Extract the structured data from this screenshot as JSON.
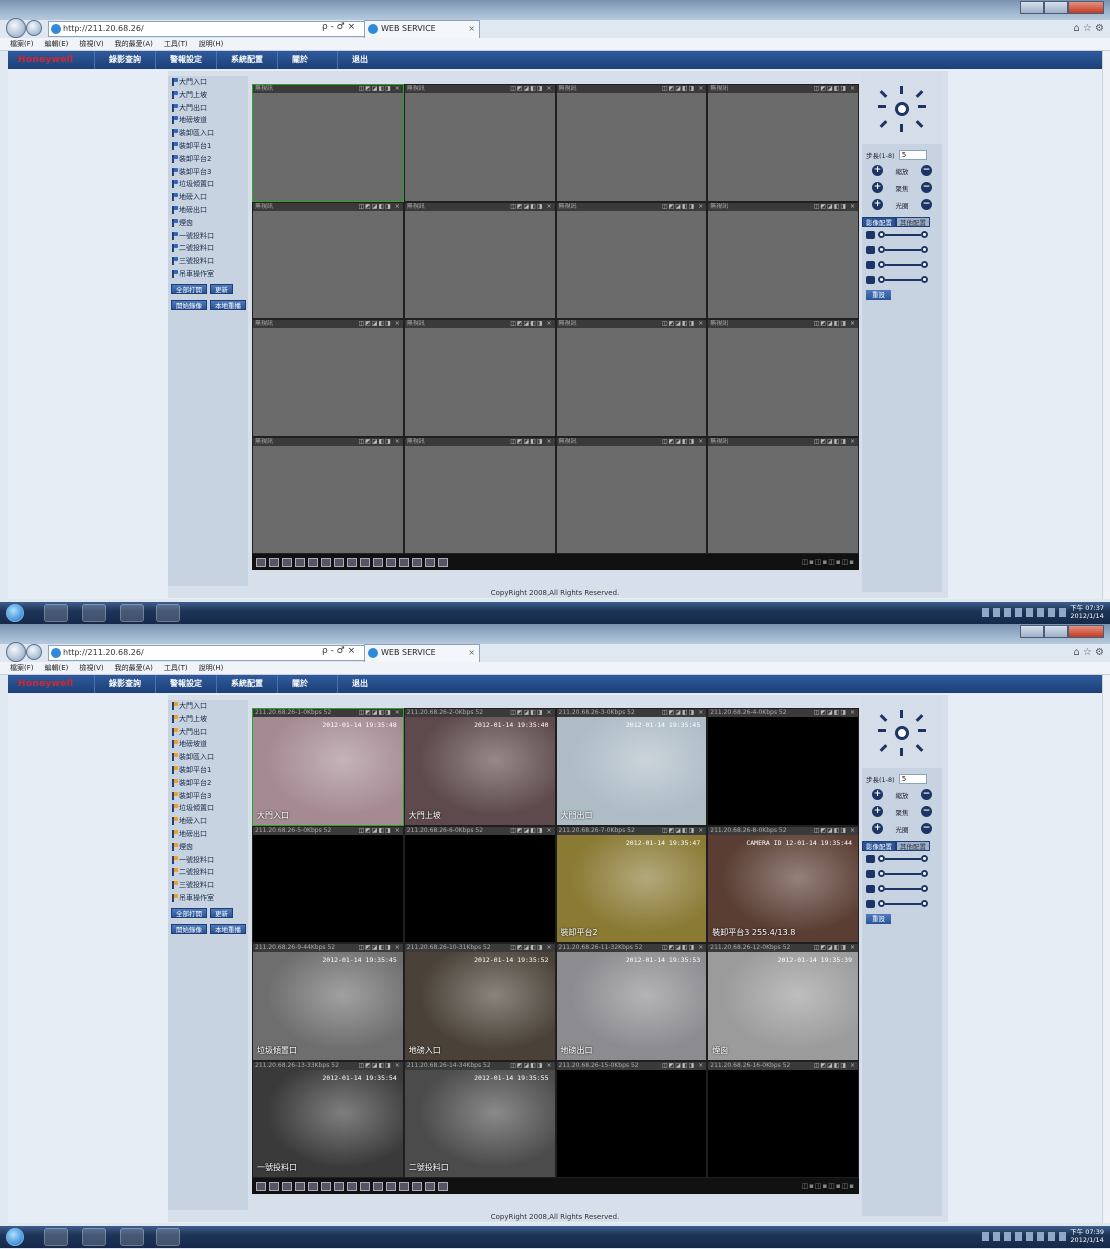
{
  "browser": {
    "url_1": "http://211.20.68.26/",
    "url_2": "http://211.20.68.26/",
    "addr_controls": "ρ - ♂ ×",
    "tab_label": "WEB SERVICE",
    "tab_close": "×"
  },
  "menu": [
    "檔案(F)",
    "編輯(E)",
    "檢視(V)",
    "我的最愛(A)",
    "工具(T)",
    "說明(H)"
  ],
  "nav": {
    "logo": "Honeywell",
    "items": [
      "錄影查詢",
      "警報設定",
      "系統配置",
      "關於",
      "退出"
    ]
  },
  "tree": {
    "items": [
      "大門入口",
      "大門上坡",
      "大門出口",
      "地磅坡道",
      "裝卸區入口",
      "裝卸平台1",
      "裝卸平台2",
      "裝卸平台3",
      "垃圾傾置口",
      "地磅入口",
      "地磅出口",
      "煙囪",
      "一號投料口",
      "二號投料口",
      "三號投料口",
      "吊車操作室"
    ],
    "btn_open_all": "全部打開",
    "btn_refresh": "更新",
    "btn_start_record": "開始錄像",
    "btn_local_playback": "本地重播"
  },
  "screen1": {
    "cells": [
      {
        "hdr": "無視訊"
      },
      {
        "hdr": "無視訊"
      },
      {
        "hdr": "無視訊"
      },
      {
        "hdr": "無視訊"
      },
      {
        "hdr": "無視訊"
      },
      {
        "hdr": "無視訊"
      },
      {
        "hdr": "無視訊"
      },
      {
        "hdr": "無視訊"
      },
      {
        "hdr": "無視訊"
      },
      {
        "hdr": "無視訊"
      },
      {
        "hdr": "無視訊"
      },
      {
        "hdr": "無視訊"
      },
      {
        "hdr": "無視訊"
      },
      {
        "hdr": "無視訊"
      },
      {
        "hdr": "無視訊"
      },
      {
        "hdr": "無視訊"
      }
    ],
    "clock_time": "下午 07:37",
    "clock_date": "2012/1/14"
  },
  "screen2": {
    "cells": [
      {
        "hdr": "211.20.68.26-1-0Kbps 52",
        "ts": "2012-01-14 19:35:48",
        "cap": "大門入口",
        "bg": "#a58a94"
      },
      {
        "hdr": "211.20.68.26-2-0Kbps 52",
        "ts": "2012-01-14 19:35:40",
        "cap": "大門上坡",
        "bg": "#5e4a4c"
      },
      {
        "hdr": "211.20.68.26-3-0Kbps 52",
        "ts": "2012-01-14 19:35:45",
        "cap": "大門出口",
        "bg": "#aebcc6"
      },
      {
        "hdr": "211.20.68.26-4-0Kbps 52",
        "ts": "",
        "cap": "",
        "bg": "#000000"
      },
      {
        "hdr": "211.20.68.26-5-0Kbps 52",
        "ts": "",
        "cap": "",
        "bg": "#000000"
      },
      {
        "hdr": "211.20.68.26-6-0Kbps 52",
        "ts": "",
        "cap": "",
        "bg": "#000000"
      },
      {
        "hdr": "211.20.68.26-7-0Kbps 52",
        "ts": "2012-01-14 19:35:47",
        "cap": "裝卸平台2",
        "bg": "#8a7a34"
      },
      {
        "hdr": "211.20.68.26-8-0Kbps 52",
        "ts": "CAMERA ID 12-01-14 19:35:44",
        "cap": "裝卸平台3   255.4/13.8",
        "bg": "#5a3e33"
      },
      {
        "hdr": "211.20.68.26-9-44Kbps 52",
        "ts": "2012-01-14 19:35:45",
        "cap": "垃圾傾置口",
        "bg": "#6e6e6e"
      },
      {
        "hdr": "211.20.68.26-10-31Kbps 52",
        "ts": "2012-01-14 19:35:52",
        "cap": "地磅入口",
        "bg": "#4a4238"
      },
      {
        "hdr": "211.20.68.26-11-32Kbps 52",
        "ts": "2012-01-14 19:35:53",
        "cap": "地磅出口",
        "bg": "#8c8c90"
      },
      {
        "hdr": "211.20.68.26-12-0Kbps 52",
        "ts": "2012-01-14 19:35:39",
        "cap": "煙囪",
        "bg": "#9b9b9b"
      },
      {
        "hdr": "211.20.68.26-13-33Kbps 52",
        "ts": "2012-01-14 19:35:54",
        "cap": "一號投料口",
        "bg": "#3a3a3a"
      },
      {
        "hdr": "211.20.68.26-14-34Kbps 52",
        "ts": "2012-01-14 19:35:55",
        "cap": "二號投料口",
        "bg": "#4b4b4b"
      },
      {
        "hdr": "211.20.68.26-15-0Kbps 52",
        "ts": "",
        "cap": "",
        "bg": "#000000"
      },
      {
        "hdr": "211.20.68.26-16-0Kbps 52",
        "ts": "",
        "cap": "",
        "bg": "#000000"
      }
    ],
    "clock_time": "下午 07:39",
    "clock_date": "2012/1/14"
  },
  "ptz": {
    "step_label": "步長(1-8)",
    "step_value": "5",
    "zoom": "縮放",
    "focus": "聚焦",
    "iris": "光圈",
    "tab_image": "影像配置",
    "tab_other": "其他配置",
    "reset": "重設"
  },
  "footer": {
    "copyright": "CopyRight 2008,All Rights Reserved."
  }
}
